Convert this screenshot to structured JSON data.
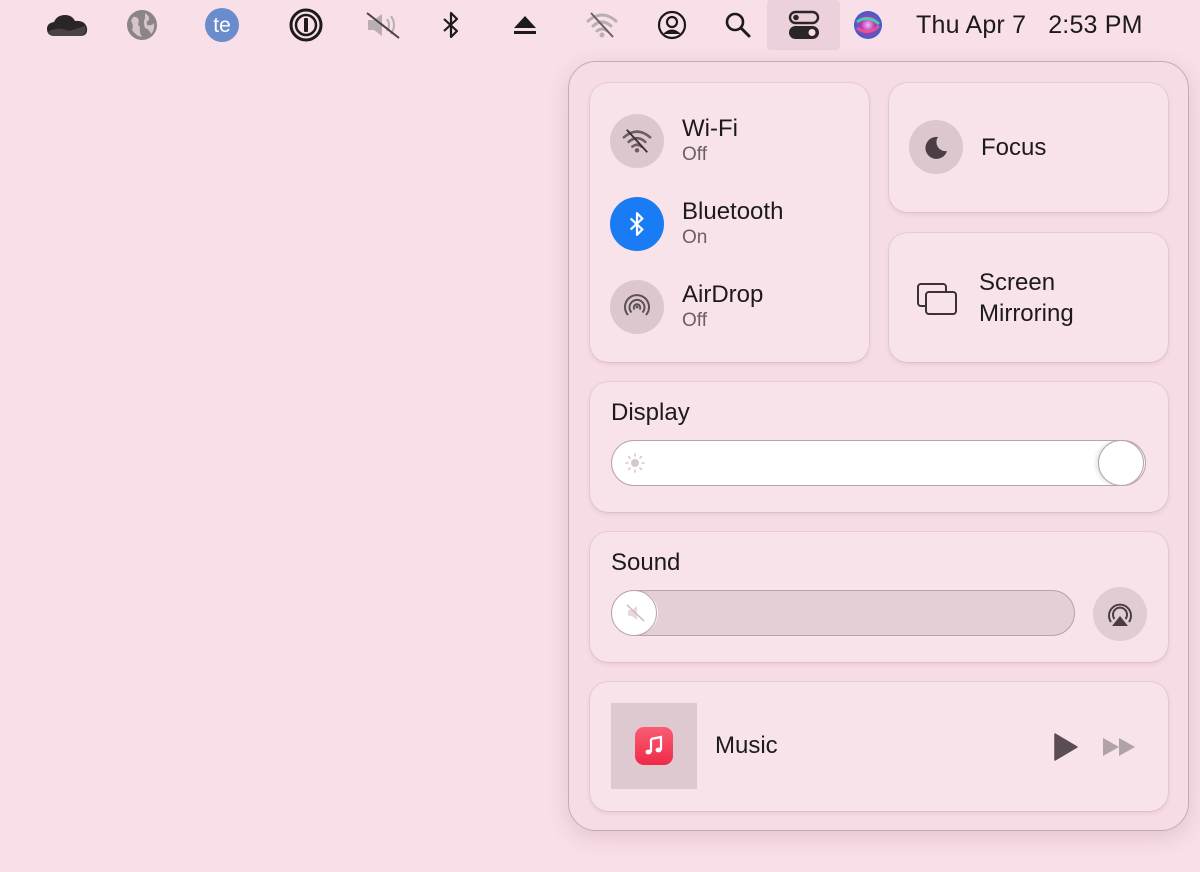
{
  "menubar": {
    "icons": [
      {
        "name": "onedrive-cloud-icon"
      },
      {
        "name": "globe-icon"
      },
      {
        "name": "te-app-icon",
        "text": "te"
      },
      {
        "name": "1password-icon"
      },
      {
        "name": "sound-muted-icon"
      },
      {
        "name": "bluetooth-icon"
      },
      {
        "name": "eject-icon"
      },
      {
        "name": "wifi-off-icon"
      },
      {
        "name": "user-account-icon"
      },
      {
        "name": "spotlight-search-icon"
      },
      {
        "name": "control-center-icon",
        "active": true
      },
      {
        "name": "siri-icon"
      }
    ],
    "date": "Thu Apr 7",
    "time": "2:53 PM"
  },
  "control_center": {
    "connectivity": [
      {
        "title": "Wi-Fi",
        "status": "Off",
        "icon": "wifi-off-icon",
        "on": false
      },
      {
        "title": "Bluetooth",
        "status": "On",
        "icon": "bluetooth-icon",
        "on": true
      },
      {
        "title": "AirDrop",
        "status": "Off",
        "icon": "airdrop-icon",
        "on": false
      }
    ],
    "focus": {
      "label": "Focus",
      "icon": "moon-icon"
    },
    "screen_mirroring": {
      "label_line1": "Screen",
      "label_line2": "Mirroring",
      "icon": "screen-mirroring-icon"
    },
    "display": {
      "title": "Display",
      "brightness_percent": 100,
      "icon": "sun-icon"
    },
    "sound": {
      "title": "Sound",
      "volume_percent": 0,
      "icon": "speaker-muted-icon",
      "output_icon": "airplay-audio-icon"
    },
    "now_playing": {
      "app": "Music",
      "icon": "music-note-icon"
    }
  },
  "colors": {
    "background": "#f9dfe8",
    "bluetooth_on": "#1a7cf5",
    "music_red": "#f0304c"
  }
}
